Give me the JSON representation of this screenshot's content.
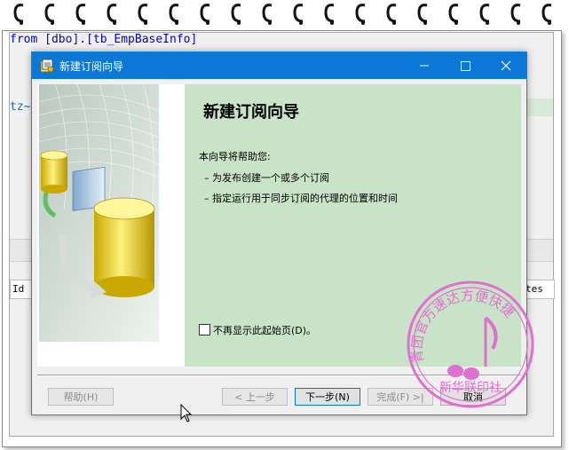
{
  "notebook": {
    "ring_count": 18,
    "ring_color": "#111111"
  },
  "editor": {
    "code_line_1": "from [dbo].[tb_EmpBaseInfo]",
    "code_line_2": "tz~",
    "grid_header_left": "Id",
    "grid_header_right": "tes"
  },
  "dialog": {
    "title": "新建订阅向导",
    "title_icon": "wizard-icon",
    "minimize_icon": "minimize-icon",
    "maximize_icon": "maximize-icon",
    "close_icon": "close-icon",
    "heading": "新建订阅向导",
    "intro": "本向导将帮助您:",
    "bullets": [
      "– 为发布创建一个或多个订阅",
      "– 指定运行用于同步订阅的代理的位置和时间"
    ],
    "checkbox_label": "不再显示此起始页(D)。",
    "checkbox_checked": false,
    "buttons": {
      "help": "帮助(H)",
      "back": "< 上一步",
      "next": "下一步(N)",
      "finish": "完成(F) >|",
      "cancel": "取消"
    },
    "accent_color": "#0b78d7",
    "banner_color": "#c9e3c9"
  },
  "watermark": {
    "text": "青团官方速达方便快捷 新华联印社",
    "color": "#e070d0"
  }
}
